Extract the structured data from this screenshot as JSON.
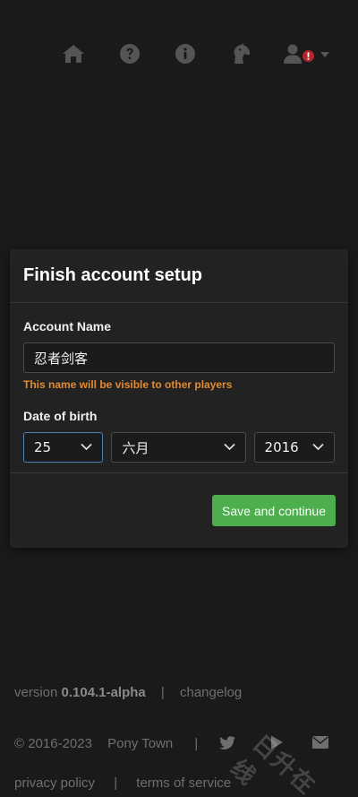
{
  "nav": {
    "icons": [
      "home-icon",
      "question-icon",
      "info-icon",
      "horse-head-icon",
      "user-icon",
      "alert-icon",
      "caret-down-icon"
    ]
  },
  "modal": {
    "title": "Finish account setup",
    "account_name_label": "Account Name",
    "account_name_value": "忍者剑客",
    "account_name_hint": "This name will be visible to other players",
    "dob_label": "Date of birth",
    "dob_day": "25",
    "dob_month": "六月",
    "dob_year": "2016",
    "save_label": "Save and continue"
  },
  "footer": {
    "version_prefix": "version",
    "version": "0.104.1-alpha",
    "changelog": "changelog",
    "copyright": "© 2016-2023",
    "app_name": "Pony Town",
    "privacy": "privacy policy",
    "terms": "terms of service",
    "separator": "|",
    "icons": [
      "twitter-icon",
      "google-play-icon",
      "mail-icon"
    ]
  },
  "watermark": "日升在线",
  "colors": {
    "background": "#1a1a1a",
    "panel": "#222222",
    "accent_button": "#4cae4c",
    "warning_text": "#e58a2e",
    "alert_badge": "#b3262b",
    "focus_border": "#4d7fb3"
  }
}
